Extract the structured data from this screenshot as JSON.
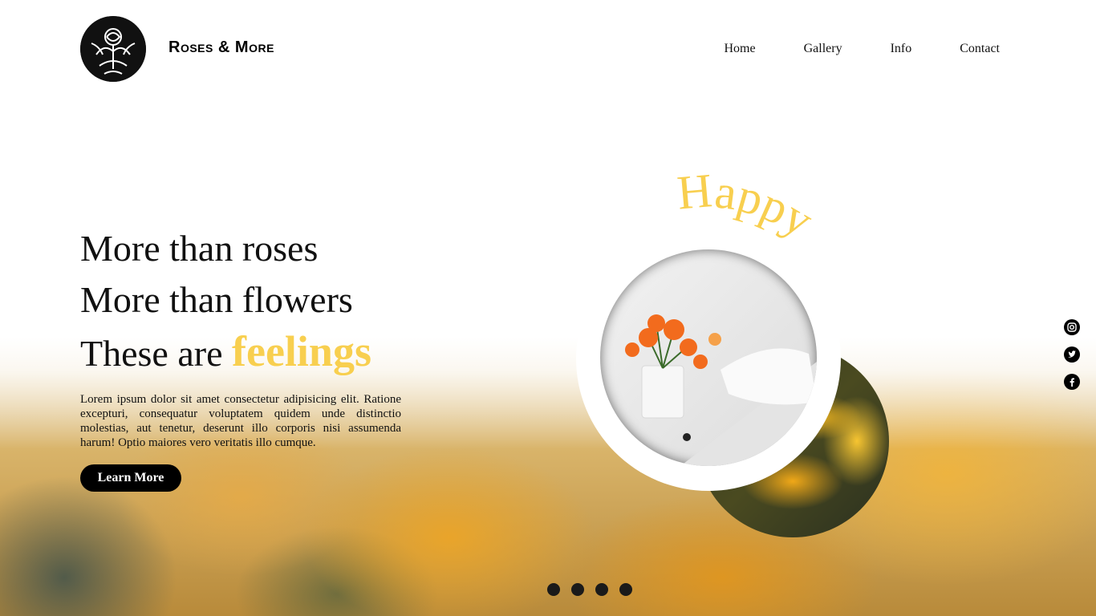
{
  "header": {
    "brand": "Roses & More",
    "logo_icon": "rose-emblem-icon",
    "nav": [
      "Home",
      "Gallery",
      "Info",
      "Contact"
    ]
  },
  "hero": {
    "line1": "More than roses",
    "line2": "More than flowers",
    "line3_prefix": "These are",
    "line3_accent": "feelings",
    "body": "Lorem ipsum dolor sit amet consectetur adipisicing elit. Ratione excepturi, consequatur voluptatem quidem unde distinctio molestias, aut tenetur, deserunt illo corporis nisi assumenda harum! Optio maiores vero veritatis illo cumque.",
    "cta": "Learn More"
  },
  "decor": {
    "arc_word": "Happy"
  },
  "social": [
    "instagram-icon",
    "twitter-icon",
    "facebook-icon"
  ],
  "slider": {
    "dots": 4,
    "active_index": 0
  },
  "colors": {
    "accent": "#f8cf4f",
    "text": "#111111",
    "button": "#000000"
  }
}
